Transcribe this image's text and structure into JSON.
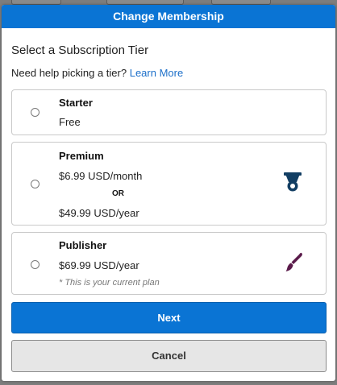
{
  "modal": {
    "title": "Change Membership",
    "section_title": "Select a Subscription Tier",
    "help_text": "Need help picking a tier?",
    "help_link": "Learn More"
  },
  "tiers": [
    {
      "name": "Starter",
      "price": "Free"
    },
    {
      "name": "Premium",
      "price_monthly": "$6.99 USD/month",
      "or_label": "OR",
      "price_yearly": "$49.99 USD/year",
      "icon": "medal-icon",
      "icon_color": "#123e63"
    },
    {
      "name": "Publisher",
      "price": "$69.99 USD/year",
      "note": "* This is your current plan",
      "icon": "paintbrush-icon",
      "icon_color": "#5a1a4a"
    }
  ],
  "buttons": {
    "next": "Next",
    "cancel": "Cancel"
  },
  "colors": {
    "header_bg": "#0a74d4",
    "link": "#1c6fc9",
    "next_bg": "#0a74d4",
    "cancel_bg": "#e6e6e6"
  }
}
